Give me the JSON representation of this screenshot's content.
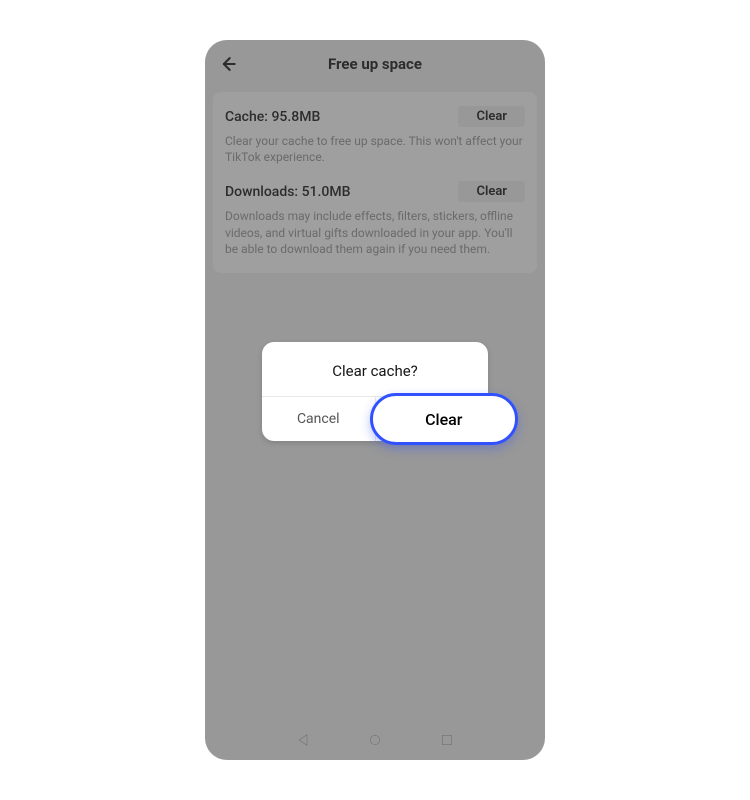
{
  "header": {
    "title": "Free up space"
  },
  "card": {
    "cache": {
      "title": "Cache: 95.8MB",
      "button": "Clear",
      "desc": "Clear your cache to free up space. This won't affect your TikTok experience."
    },
    "downloads": {
      "title": "Downloads: 51.0MB",
      "button": "Clear",
      "desc": "Downloads may include effects, filters, stickers, offline videos, and virtual gifts downloaded in your app. You'll be able to download them again if you need them."
    }
  },
  "dialog": {
    "title": "Clear cache?",
    "cancel": "Cancel",
    "confirm": "Clear"
  }
}
